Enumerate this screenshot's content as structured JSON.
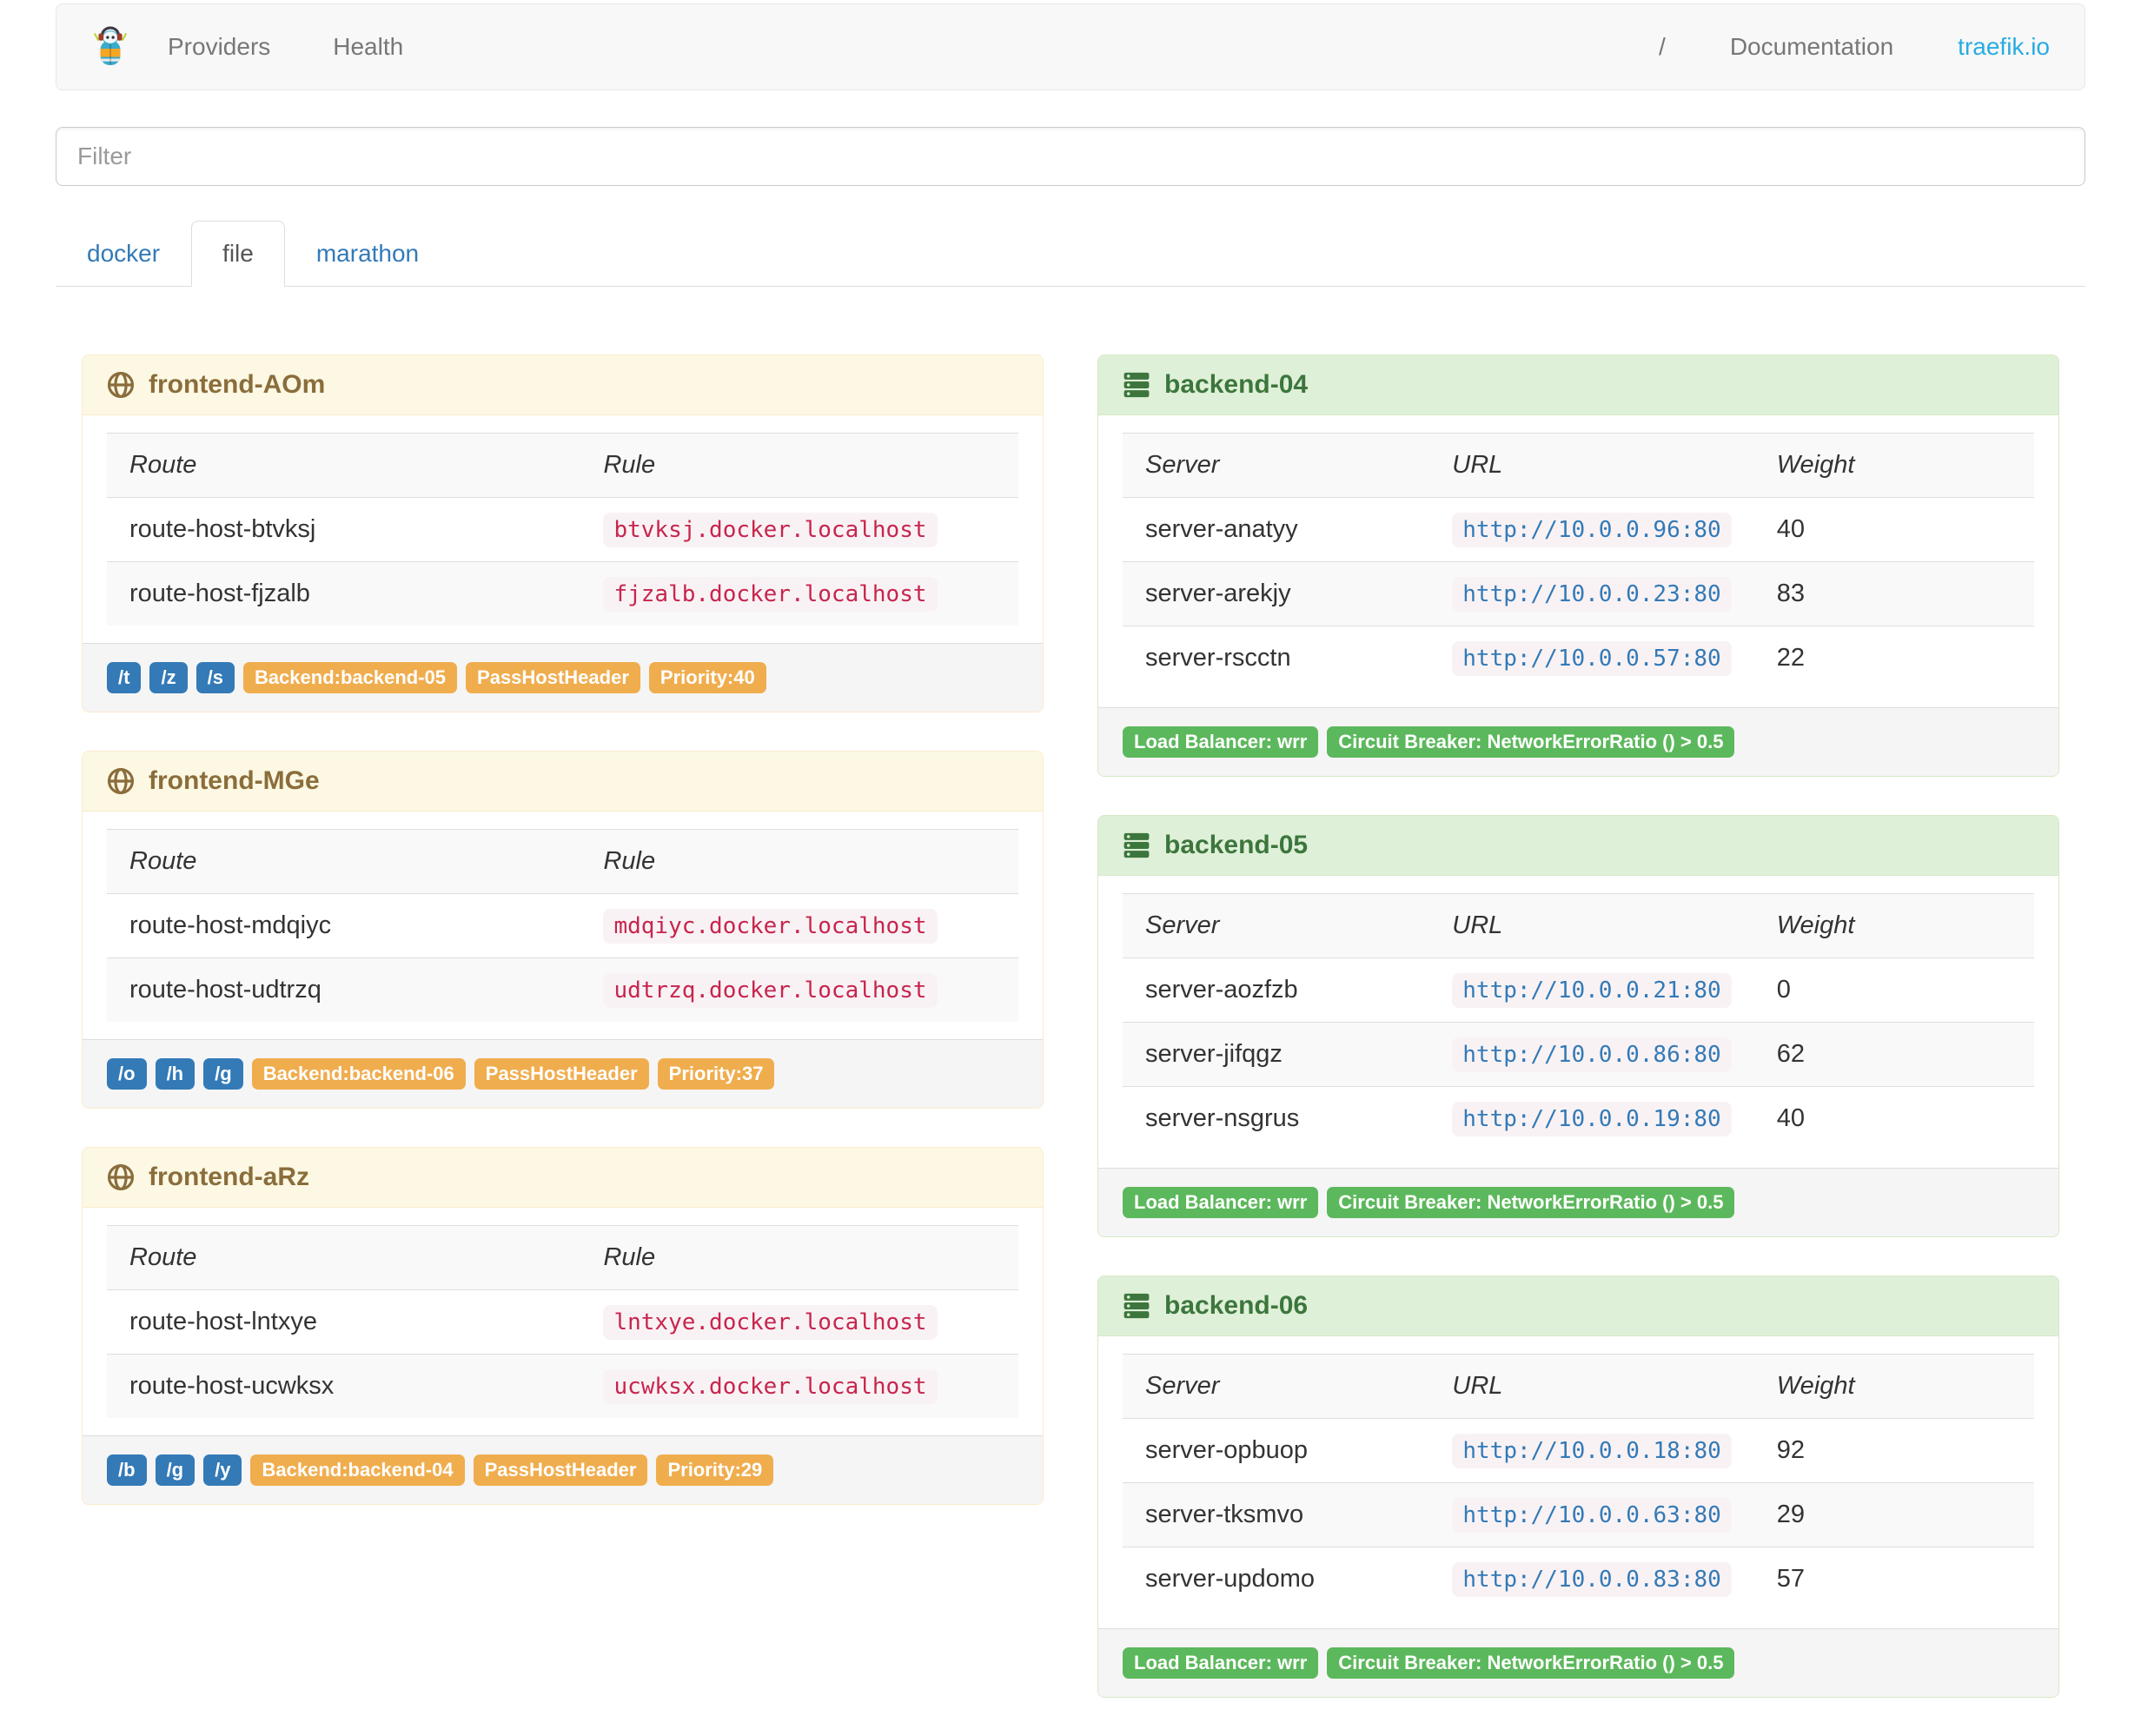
{
  "navbar": {
    "links": [
      "Providers",
      "Health"
    ],
    "right_links": [
      "/",
      "Documentation",
      "traefik.io"
    ]
  },
  "filter": {
    "placeholder": "Filter"
  },
  "tabs": [
    {
      "label": "docker",
      "active": false
    },
    {
      "label": "file",
      "active": true
    },
    {
      "label": "marathon",
      "active": false
    }
  ],
  "frontend_columns": [
    "Route",
    "Rule"
  ],
  "backend_columns": [
    "Server",
    "URL",
    "Weight"
  ],
  "frontends": [
    {
      "name": "frontend-AOm",
      "routes": [
        {
          "route": "route-host-btvksj",
          "rule": "btvksj.docker.localhost"
        },
        {
          "route": "route-host-fjzalb",
          "rule": "fjzalb.docker.localhost"
        }
      ],
      "entry_points": [
        "/t",
        "/z",
        "/s"
      ],
      "tags": [
        "Backend:backend-05",
        "PassHostHeader",
        "Priority:40"
      ]
    },
    {
      "name": "frontend-MGe",
      "routes": [
        {
          "route": "route-host-mdqiyc",
          "rule": "mdqiyc.docker.localhost"
        },
        {
          "route": "route-host-udtrzq",
          "rule": "udtrzq.docker.localhost"
        }
      ],
      "entry_points": [
        "/o",
        "/h",
        "/g"
      ],
      "tags": [
        "Backend:backend-06",
        "PassHostHeader",
        "Priority:37"
      ]
    },
    {
      "name": "frontend-aRz",
      "routes": [
        {
          "route": "route-host-lntxye",
          "rule": "lntxye.docker.localhost"
        },
        {
          "route": "route-host-ucwksx",
          "rule": "ucwksx.docker.localhost"
        }
      ],
      "entry_points": [
        "/b",
        "/g",
        "/y"
      ],
      "tags": [
        "Backend:backend-04",
        "PassHostHeader",
        "Priority:29"
      ]
    }
  ],
  "backends": [
    {
      "name": "backend-04",
      "servers": [
        {
          "server": "server-anatyy",
          "url": "http://10.0.0.96:80",
          "weight": "40"
        },
        {
          "server": "server-arekjy",
          "url": "http://10.0.0.23:80",
          "weight": "83"
        },
        {
          "server": "server-rscctn",
          "url": "http://10.0.0.57:80",
          "weight": "22"
        }
      ],
      "tags": [
        "Load Balancer: wrr",
        "Circuit Breaker: NetworkErrorRatio () > 0.5"
      ]
    },
    {
      "name": "backend-05",
      "servers": [
        {
          "server": "server-aozfzb",
          "url": "http://10.0.0.21:80",
          "weight": "0"
        },
        {
          "server": "server-jifqgz",
          "url": "http://10.0.0.86:80",
          "weight": "62"
        },
        {
          "server": "server-nsgrus",
          "url": "http://10.0.0.19:80",
          "weight": "40"
        }
      ],
      "tags": [
        "Load Balancer: wrr",
        "Circuit Breaker: NetworkErrorRatio () > 0.5"
      ]
    },
    {
      "name": "backend-06",
      "servers": [
        {
          "server": "server-opbuop",
          "url": "http://10.0.0.18:80",
          "weight": "92"
        },
        {
          "server": "server-tksmvo",
          "url": "http://10.0.0.63:80",
          "weight": "29"
        },
        {
          "server": "server-updomo",
          "url": "http://10.0.0.83:80",
          "weight": "57"
        }
      ],
      "tags": [
        "Load Balancer: wrr",
        "Circuit Breaker: NetworkErrorRatio () > 0.5"
      ]
    }
  ],
  "colors": {
    "brand_accent": "#29abe2",
    "label_primary": "#337ab7",
    "label_warning": "#f0ad4e",
    "label_success": "#5cb85c",
    "frontend_heading_text": "#8a6d3b",
    "frontend_heading_bg": "#fcf8e3",
    "backend_heading_text": "#3c763d",
    "backend_heading_bg": "#dff0d8",
    "code_text": "#c7254e",
    "code_bg": "#f9f2f4"
  }
}
